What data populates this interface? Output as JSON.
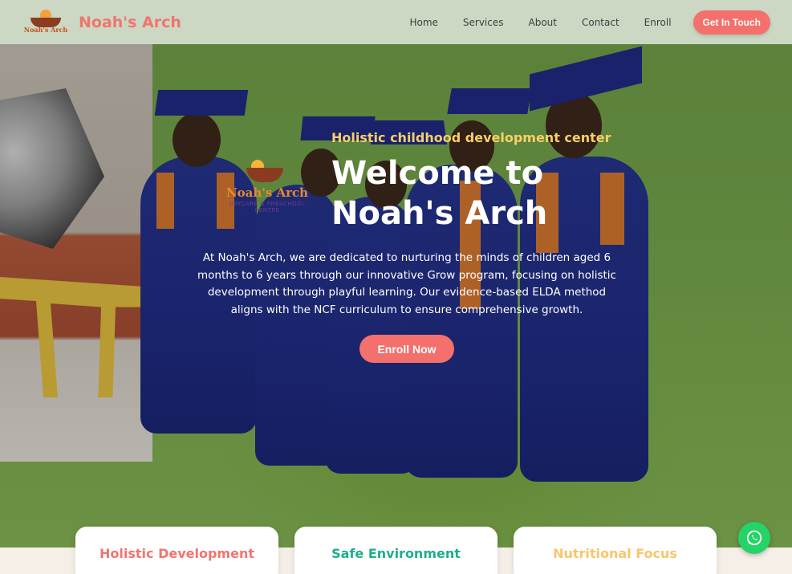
{
  "nav": {
    "logo_text": "Noah's Arch",
    "brand": "Noah's Arch",
    "links": [
      "Home",
      "Services",
      "About",
      "Contact",
      "Enroll"
    ],
    "cta": "Get In Touch"
  },
  "hero": {
    "logo_title": "Noah's Arch",
    "logo_sub": "DAYCARE & PRESCHOOL CENTRE",
    "tagline": "Holistic childhood development center",
    "headline": "Welcome to Noah's Arch",
    "description": "At Noah's Arch, we are dedicated to nurturing the minds of children aged 6 months to 6 years through our innovative Grow program, focusing on holistic development through playful learning. Our evidence-based ELDA method aligns with the NCF curriculum to ensure comprehensive growth.",
    "button": "Enroll Now"
  },
  "features": [
    {
      "title": "Holistic Development",
      "color": "#f2746e"
    },
    {
      "title": "Safe Environment",
      "color": "#1fae8c"
    },
    {
      "title": "Nutritional Focus",
      "color": "#f7c66b"
    }
  ],
  "whatsapp": {
    "icon": "whatsapp-icon"
  },
  "colors": {
    "accent": "#f3706c",
    "tagline": "#f7d067",
    "nav_bg": "#ecf1eb"
  }
}
